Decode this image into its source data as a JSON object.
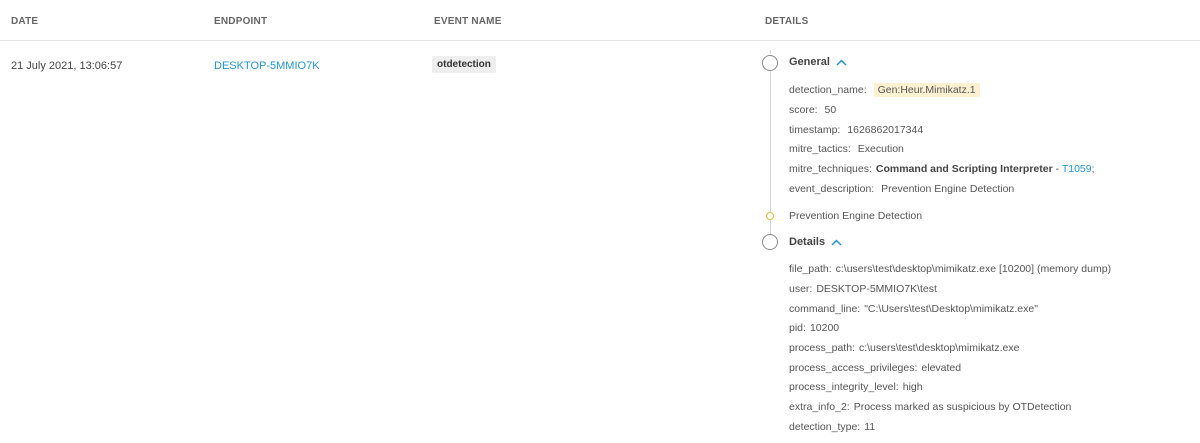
{
  "columns": {
    "date": "DATE",
    "endpoint": "ENDPOINT",
    "event_name": "EVENT NAME",
    "details": "DETAILS"
  },
  "row": {
    "date": "21 July 2021, 13:06:57",
    "endpoint": "DESKTOP-5MMIO7K",
    "event_name": "otdetection"
  },
  "general": {
    "title": "General",
    "detection_name_key": "detection_name:",
    "detection_name_value": "Gen:Heur.Mimikatz.1",
    "score_key": "score:",
    "score_value": "50",
    "timestamp_key": "timestamp:",
    "timestamp_value": "1626862017344",
    "mitre_tactics_key": "mitre_tactics:",
    "mitre_tactics_value": "Execution",
    "mitre_techniques_key": "mitre_techniques:",
    "mitre_techniques_name": "Command and Scripting Interpreter",
    "mitre_techniques_sep": " - ",
    "mitre_techniques_id": "T1059",
    "mitre_techniques_suffix": ";",
    "event_description_key": "event_description:",
    "event_description_value": "Prevention Engine Detection"
  },
  "timeline_event": "Prevention Engine Detection",
  "details": {
    "title": "Details",
    "items": [
      {
        "key": "file_path:",
        "value": "c:\\users\\test\\desktop\\mimikatz.exe [10200] (memory dump)"
      },
      {
        "key": "user:",
        "value": "DESKTOP-5MMIO7K\\test"
      },
      {
        "key": "command_line:",
        "value": "\"C:\\Users\\test\\Desktop\\mimikatz.exe\""
      },
      {
        "key": "pid:",
        "value": "10200"
      },
      {
        "key": "process_path:",
        "value": "c:\\users\\test\\desktop\\mimikatz.exe"
      },
      {
        "key": "process_access_privileges:",
        "value": "elevated"
      },
      {
        "key": "process_integrity_level:",
        "value": "high"
      },
      {
        "key": "extra_info_2:",
        "value": "Process marked as suspicious by OTDetection"
      },
      {
        "key": "detection_type:",
        "value": "11"
      }
    ]
  },
  "colors": {
    "link": "#2196d3",
    "highlight": "#fdf1d2",
    "timeline_dot": "#e8b84a"
  }
}
